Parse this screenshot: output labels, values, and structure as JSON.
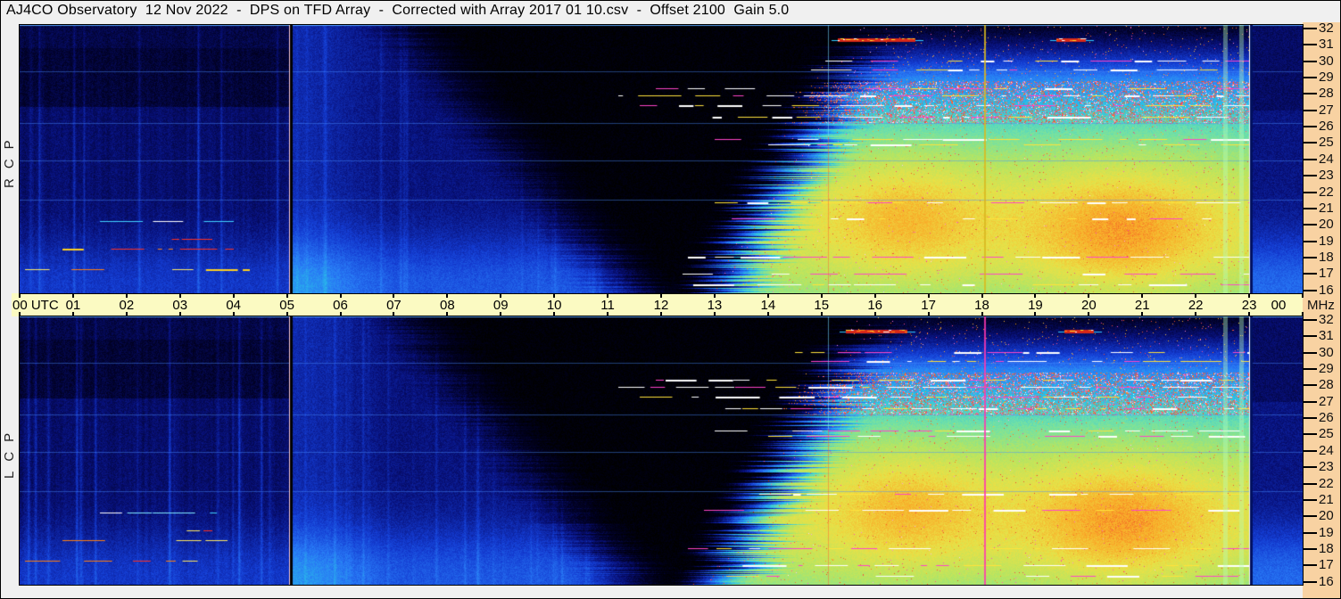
{
  "header": {
    "title": "AJ4CO Observatory  12 Nov 2022  -  DPS on TFD Array  -  Corrected with Array 2017 01 10.csv  -  Offset 2100  Gain 5.0"
  },
  "colors": {
    "page_bg": "#f0f0f0",
    "time_strip_bg": "#fbfac2",
    "freq_col_bg": "#f8d2a2",
    "axis_text": "#000000",
    "border": "#000000"
  },
  "time_axis": {
    "utc_suffix": "UTC",
    "labels": [
      "00",
      "01",
      "02",
      "03",
      "04",
      "05",
      "06",
      "07",
      "08",
      "09",
      "10",
      "11",
      "12",
      "13",
      "14",
      "15",
      "16",
      "17",
      "18",
      "19",
      "20",
      "21",
      "22",
      "23",
      "00"
    ],
    "mhz_label": "MHz"
  },
  "freq_axis": {
    "ticks": [
      32,
      31,
      30,
      29,
      28,
      27,
      26,
      25,
      24,
      23,
      22,
      21,
      20,
      19,
      18,
      17,
      16
    ],
    "unit": "MHz"
  },
  "panels": [
    {
      "id": "rcp",
      "label": "RCP"
    },
    {
      "id": "lcp",
      "label": "LCP"
    }
  ],
  "chart_data": {
    "type": "heatmap",
    "title": "AJ4CO Observatory dynamic spectrum, 12 Nov 2022, DPS on TFD Array, RCP and LCP polarizations",
    "x_axis": {
      "label": "UTC",
      "range_hours": [
        0,
        24
      ],
      "hour_tick_step": 1
    },
    "y_axis": {
      "label": "MHz",
      "range_mhz": [
        16,
        32
      ],
      "tick_step_mhz": 1,
      "top_mhz": 32.2,
      "bottom_mhz": 15.8
    },
    "panels": [
      {
        "id": "rcp",
        "polarization": "RCP",
        "seed": 1211202201
      },
      {
        "id": "lcp",
        "polarization": "LCP",
        "seed": 1211202277
      }
    ],
    "regions": {
      "quiet_night_utc": [
        0,
        5.08
      ],
      "receiver_restart_utc": 5.08,
      "dark_galactic_minimum_utc": [
        8,
        13
      ],
      "daytime_emission_utc": [
        13,
        23.02
      ],
      "day_end_utc": 23.02,
      "sunrise_base_utc": 12.55,
      "sunrise_slope_utc_per_mhz": 0.17,
      "dark_start_utc": 7.4,
      "dark_slope_utc_per_mhz": 0.26,
      "day_peak_mhz": 20,
      "day_blobs": [
        {
          "t": 16.6,
          "t_sigma": 1.5,
          "f": 20.6,
          "f_sigma": 4.2,
          "amp": 0.1
        },
        {
          "t": 20.6,
          "t_sigma": 1.8,
          "f": 19.4,
          "f_sigma": 4.6,
          "amp": 0.13
        }
      ]
    },
    "bursts": {
      "rcp": [
        {
          "f_mhz": 31.35,
          "t0": 15.3,
          "t1": 16.75
        },
        {
          "f_mhz": 31.35,
          "t0": 19.4,
          "t1": 19.95
        }
      ],
      "lcp": [
        {
          "f_mhz": 31.35,
          "t0": 15.45,
          "t1": 16.6
        },
        {
          "f_mhz": 31.35,
          "t0": 19.55,
          "t1": 20.1
        }
      ]
    },
    "vertical_lines": [
      {
        "t": 5.08,
        "kind": "black",
        "panels": [
          "rcp",
          "lcp"
        ]
      },
      {
        "t": 15.12,
        "kind": "cyan-red",
        "panels": [
          "rcp",
          "lcp"
        ]
      },
      {
        "t": 18.05,
        "kind": "orange",
        "panels": [
          "rcp"
        ],
        "color": "rgba(216,184,32,0.85)"
      },
      {
        "t": 18.05,
        "kind": "orange",
        "panels": [
          "lcp"
        ],
        "color": "rgba(255,56,176,0.85)"
      },
      {
        "t": 22.55,
        "kind": "bright",
        "panels": [
          "rcp",
          "lcp"
        ]
      },
      {
        "t": 22.85,
        "kind": "bright",
        "panels": [
          "rcp",
          "lcp"
        ]
      },
      {
        "t": 23.02,
        "kind": "white-navy",
        "panels": [
          "rcp",
          "lcp"
        ]
      }
    ],
    "rfi_lines": [
      {
        "f": 28.35,
        "t0": 11.9,
        "t1": 23.0,
        "style": "mix"
      },
      {
        "f": 27.9,
        "t0": 11.2,
        "t1": 23.0,
        "style": "mix"
      },
      {
        "f": 27.3,
        "t0": 11.6,
        "t1": 23.0,
        "style": "mix"
      },
      {
        "f": 26.6,
        "t0": 12.3,
        "t1": 23.0,
        "style": "mix"
      },
      {
        "f": 25.2,
        "t0": 13.0,
        "t1": 23.0,
        "style": "white"
      },
      {
        "f": 24.9,
        "t0": 14.0,
        "t1": 23.0,
        "style": "mix"
      },
      {
        "f": 21.35,
        "t0": 13.0,
        "t1": 23.0,
        "style": "white"
      },
      {
        "f": 20.4,
        "t0": 12.8,
        "t1": 23.0,
        "style": "white"
      },
      {
        "f": 18.05,
        "t0": 12.5,
        "t1": 23.0,
        "style": "mix"
      },
      {
        "f": 17.0,
        "t0": 12.4,
        "t1": 23.0,
        "style": "mix"
      },
      {
        "f": 16.35,
        "t0": 12.6,
        "t1": 23.0,
        "style": "white"
      },
      {
        "f": 30.0,
        "t0": 14.5,
        "t1": 23.0,
        "style": "mix"
      },
      {
        "f": 29.5,
        "t0": 14.8,
        "t1": 23.0,
        "style": "mix"
      },
      {
        "f": 17.25,
        "t0": 0.1,
        "t1": 4.3,
        "style": "warm"
      },
      {
        "f": 18.5,
        "t0": 0.8,
        "t1": 4.0,
        "style": "warm"
      },
      {
        "f": 19.1,
        "t0": 2.2,
        "t1": 3.6,
        "style": "warm"
      },
      {
        "f": 20.2,
        "t0": 1.5,
        "t1": 4.0,
        "style": "cool"
      }
    ],
    "night_blue_lines_mhz": [
      29.35,
      26.2,
      23.9,
      21.5
    ],
    "rfi_speckle_band_mhz": [
      26.2,
      28.8
    ]
  }
}
